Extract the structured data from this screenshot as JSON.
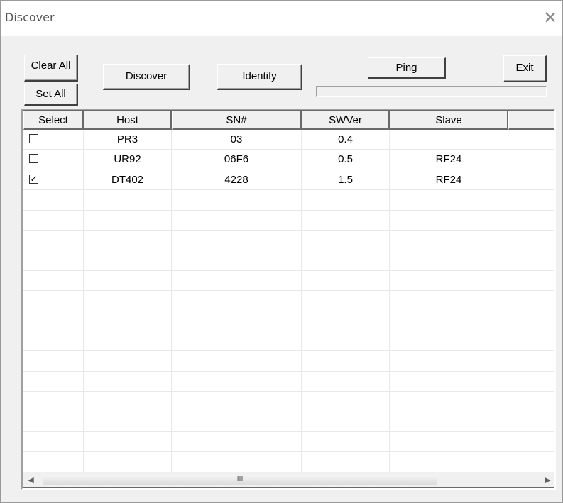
{
  "window": {
    "title": "Discover",
    "close_glyph": "✕"
  },
  "toolbar": {
    "clear_all": "Clear All",
    "set_all": "Set All",
    "discover": "Discover",
    "identify": "Identify",
    "ping": "Ping",
    "exit": "Exit",
    "progress": 0
  },
  "table": {
    "columns": [
      "Select",
      "Host",
      "SN#",
      "SWVer",
      "Slave"
    ],
    "rows": [
      {
        "selected": false,
        "host": "PR3",
        "sn": "03",
        "swver": "0.4",
        "slave": ""
      },
      {
        "selected": false,
        "host": "UR92",
        "sn": "06F6",
        "swver": "0.5",
        "slave": "RF24"
      },
      {
        "selected": true,
        "host": "DT402",
        "sn": "4228",
        "swver": "1.5",
        "slave": "RF24"
      }
    ],
    "check_glyph": "✓"
  },
  "scrollbar": {
    "left_arrow_icon": "left-arrow-icon",
    "right_arrow_icon": "right-arrow-icon",
    "left_glyph": "◀",
    "right_glyph": "▶",
    "grip": "III"
  }
}
